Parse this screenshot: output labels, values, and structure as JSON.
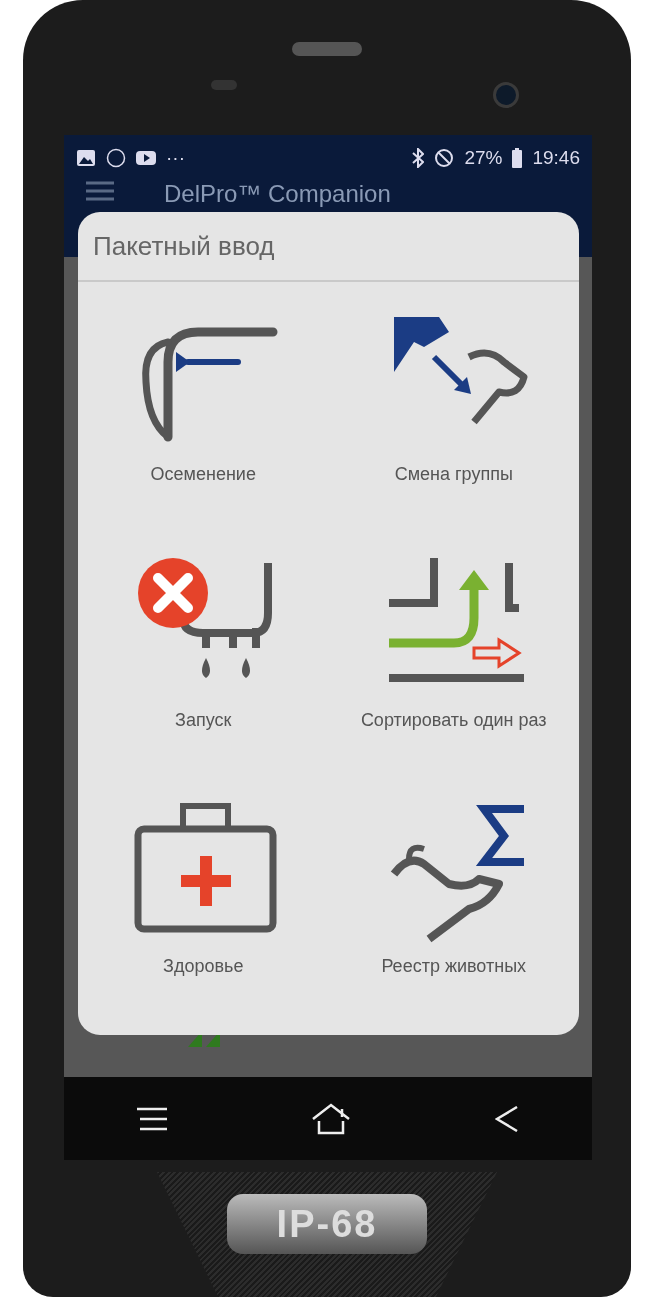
{
  "status_bar": {
    "more": "···",
    "battery": "27%",
    "time": "19:46"
  },
  "app_bar": {
    "title": "DelPro™ Companion"
  },
  "dialog": {
    "title": "Пакетный ввод",
    "items": [
      {
        "label": "Осеменение",
        "kind": "insemination"
      },
      {
        "label": "Смена группы",
        "kind": "group-change"
      },
      {
        "label": "Запуск",
        "kind": "dry-off"
      },
      {
        "label": "Сортировать один раз",
        "kind": "sort-once"
      },
      {
        "label": "Здоровье",
        "kind": "health"
      },
      {
        "label": "Реестр животных",
        "kind": "animal-register"
      }
    ]
  },
  "device": {
    "badge": "IP-68"
  }
}
